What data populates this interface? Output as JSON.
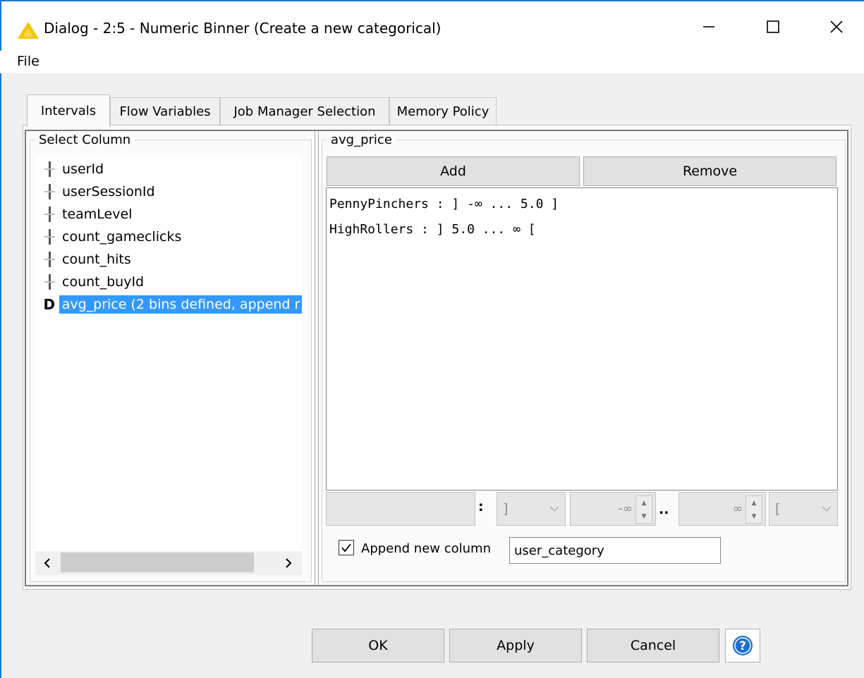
{
  "window": {
    "title": "Dialog - 2:5 - Numeric Binner (Create a new categorical)",
    "icon": "warning-icon",
    "controls": [
      "minimize",
      "maximize",
      "close"
    ]
  },
  "menu": {
    "items": [
      "File"
    ]
  },
  "tabs": [
    {
      "label": "Intervals",
      "active": true
    },
    {
      "label": "Flow Variables",
      "active": false
    },
    {
      "label": "Job Manager Selection",
      "active": false
    },
    {
      "label": "Memory Policy",
      "active": false
    }
  ],
  "select_column": {
    "title": "Select Column",
    "items": [
      {
        "label": "userId",
        "type": "I",
        "selected": false
      },
      {
        "label": "userSessionId",
        "type": "I",
        "selected": false
      },
      {
        "label": "teamLevel",
        "type": "I",
        "selected": false
      },
      {
        "label": "count_gameclicks",
        "type": "I",
        "selected": false
      },
      {
        "label": "count_hits",
        "type": "I",
        "selected": false
      },
      {
        "label": "count_buyId",
        "type": "I",
        "selected": false
      },
      {
        "label": "avg_price (2 bins defined, append r",
        "type": "D",
        "selected": true
      }
    ],
    "scroll_left": "‹",
    "scroll_right": "›"
  },
  "bins_panel": {
    "title": "avg_price",
    "add_label": "Add",
    "remove_label": "Remove",
    "bins": [
      "PennyPinchers : ] -∞ ... 5.0 ]",
      "HighRollers : ] 5.0 ... ∞ ["
    ],
    "editor": {
      "name_value": "",
      "colon": ":",
      "left_bracket": "]",
      "left_value": "-∞",
      "dots": "..",
      "right_value": "∞",
      "right_bracket": "["
    },
    "append_checked": true,
    "append_label": "Append new column",
    "append_value": "user_category"
  },
  "footer": {
    "ok_label": "OK",
    "apply_label": "Apply",
    "cancel_label": "Cancel",
    "help_icon": "help-icon"
  },
  "colors": {
    "selection": "#3399ff",
    "warning": "#f5c400",
    "help": "#1a6fd6"
  }
}
